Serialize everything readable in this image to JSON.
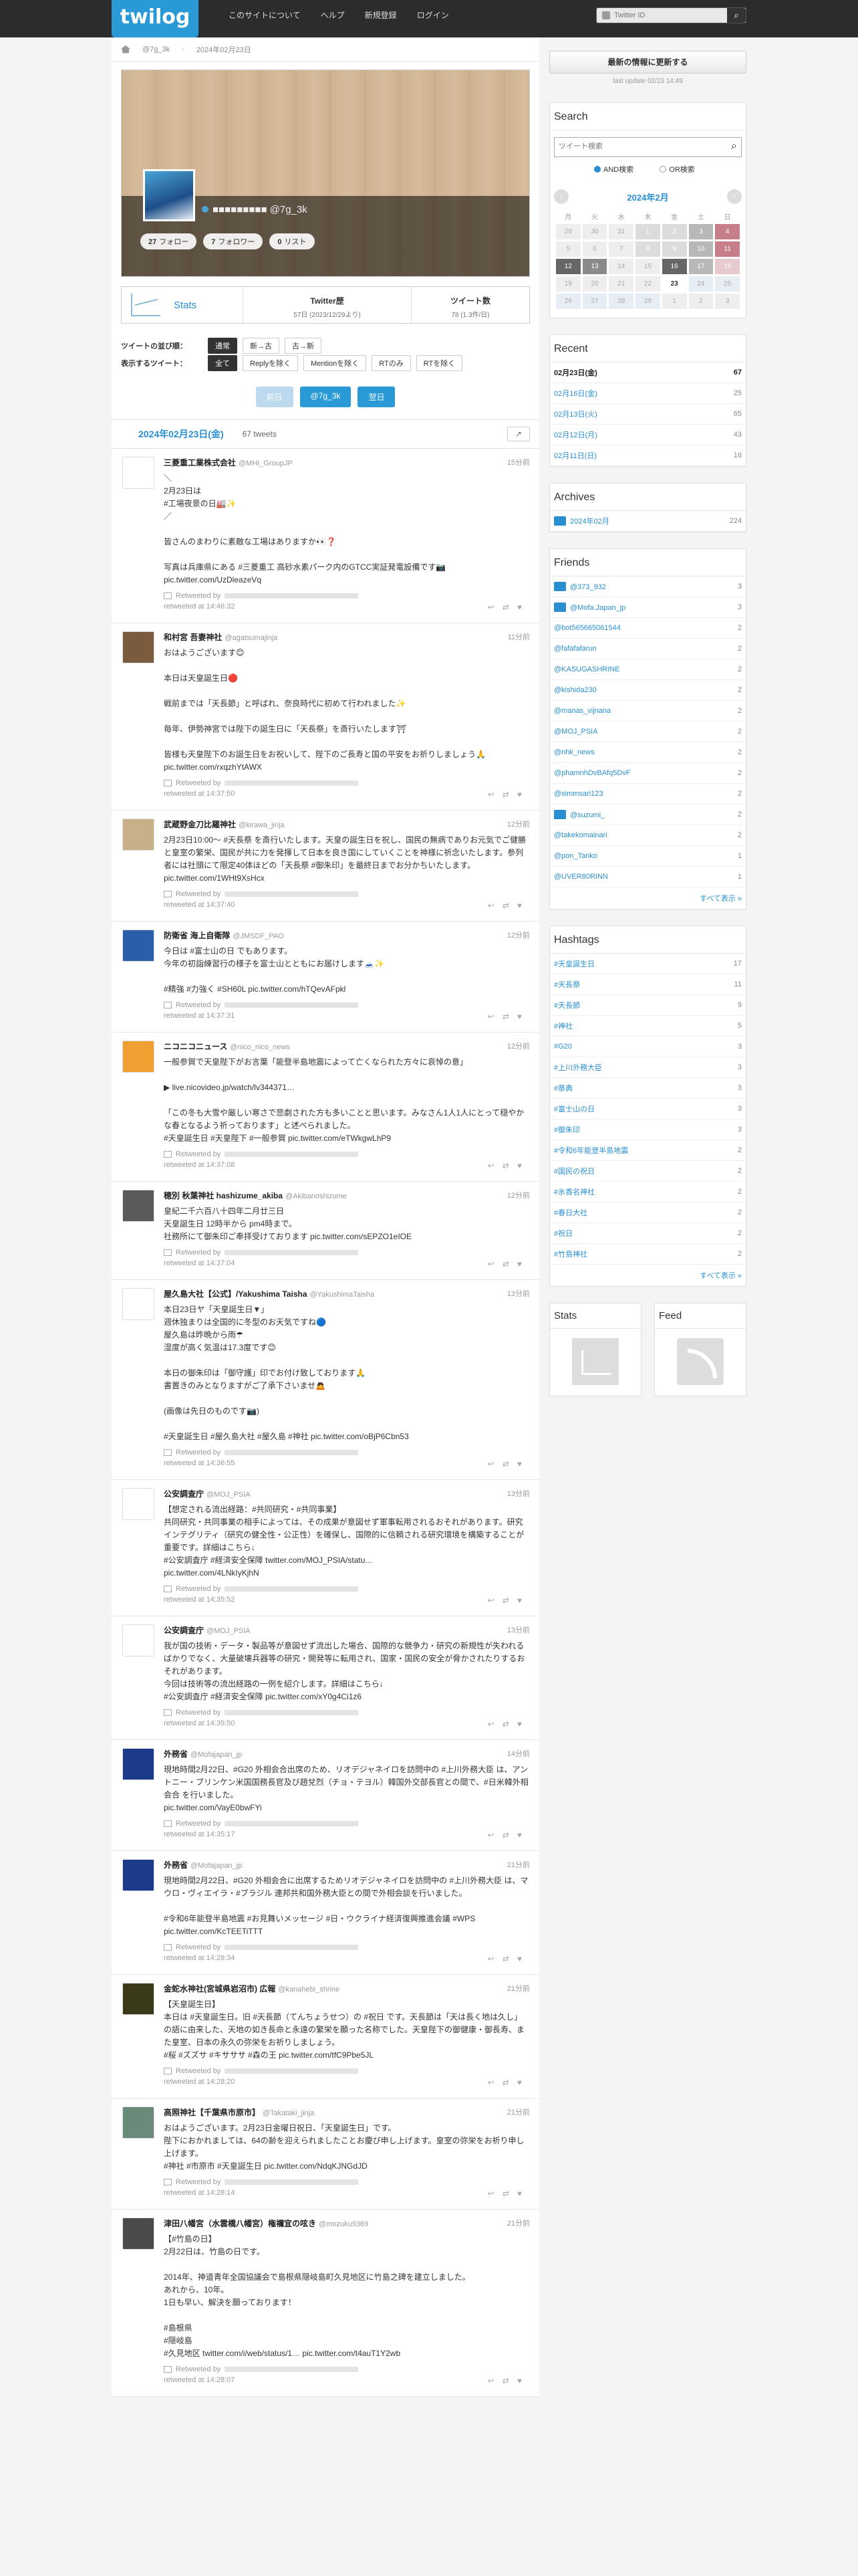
{
  "topbar": {
    "logo": "twilog",
    "nav": [
      "このサイトについて",
      "ヘルプ",
      "新規登録",
      "ログイン"
    ],
    "search_placeholder": "Twitter ID"
  },
  "breadcrumb": {
    "user": "@7g_3k",
    "date": "2024年02月23日"
  },
  "profile": {
    "name_masked": "■■■■■■■■■ @7g_3k",
    "pills": [
      {
        "num": "27",
        "label": "フォロー"
      },
      {
        "num": "7",
        "label": "フォロワー"
      },
      {
        "num": "0",
        "label": "リスト"
      }
    ]
  },
  "stats": {
    "label": "Stats",
    "twitter_reki_title": "Twitter歴",
    "twitter_reki_value": "57日 (2023/12/29より)",
    "tweets_title": "ツイート数",
    "tweets_value": "78 (1.3件/日)"
  },
  "options": {
    "order_label": "ツイートの並び順：",
    "order_buttons": [
      "通常",
      "新→古",
      "古→新"
    ],
    "display_label": "表示するツイート：",
    "display_buttons": [
      "全て",
      "Replyを除く",
      "Mentionを除く",
      "RTのみ",
      "RTを除く"
    ]
  },
  "pager": {
    "prev": "前日",
    "user": "@7g_3k",
    "next": "翌日"
  },
  "day": {
    "date": "2024年02月23日(金)",
    "count": "67 tweets",
    "share": "↗"
  },
  "tweets": [
    {
      "name": "三菱重工業株式会社",
      "sn": "@MHI_GroupJP",
      "time": "15分前",
      "av": "#fff url() ",
      "avc": "#ffffff",
      "avb": "#d00",
      "body": "＼\n2月23日は\n#工場夜景の日🏭✨\n／\n\n皆さんのまわりに素敵な工場はありますか👀❓\n\n写真は兵庫県にある #三菱重工 高砂水素パーク内のGTCC実証発電設備です📷\npic.twitter.com/UzDleazeVq",
      "at": "retweeted at 14:46:32"
    },
    {
      "name": "和村宮 吾妻神社",
      "sn": "@agatsumajinja",
      "time": "11分前",
      "avc": "#7a5b3e",
      "body": "おはようございます😊\n\n本日は天皇誕生日🔴\n\n戦前までは「天長節」と呼ばれ、奈良時代に初めて行われました✨\n\n毎年、伊勢神宮では陛下の誕生日に「天長祭」を斎行いたします⛩\n\n皆様も天皇陛下のお誕生日をお祝いして、陛下のご長寿と国の平安をお祈りしましょう🙏 pic.twitter.com/rxqzhYtAWX",
      "at": "retweeted at 14:37:50"
    },
    {
      "name": "武蔵野金刀比羅神社",
      "sn": "@kirawa_jinja",
      "time": "12分前",
      "avc": "#c8b08a",
      "body": "2月23日10:00〜 #天長祭 を斎行いたします。天皇の誕生日を祝し、国民の無病でありお元気でご健勝と皇室の繁栄、国民が共に力を発揮して日本を良き国にしていくことを神様に祈念いたします。参列者には社頭にて限定40体ほどの「天長祭 #御朱印」を最終日までお分かちいたします。 pic.twitter.com/1WHt9XsHcx",
      "at": "retweeted at 14:37:40"
    },
    {
      "name": "防衛省 海上自衛隊",
      "sn": "@JMSDF_PAO",
      "time": "12分前",
      "avc": "#2a5ea8",
      "body": "今日は #富士山の日 でもあります。\n今年の初詣練習行の様子を富士山とともにお届けします🗻✨\n\n#精強 #力強く #SH60L pic.twitter.com/hTQevAFpkl",
      "at": "retweeted at 14:37:31"
    },
    {
      "name": "ニコニコニュース",
      "sn": "@nico_nico_news",
      "time": "12分前",
      "avc": "#f0a030",
      "body": "一般参賀で天皇陛下がお言葉「能登半島地震によって亡くなられた方々に哀悼の意」\n\n▶ live.nicovideo.jp/watch/lv344371…\n\n「この冬も大雪や厳しい寒さで悲劇された方も多いことと思います。みなさん1人1人にとって穏やかな春となるよう祈っております」と述べられました。\n#天皇誕生日 #天皇陛下 #一般参賀 pic.twitter.com/eTWkgwLhP9",
      "at": "retweeted at 14:37:08"
    },
    {
      "name": "穂別 秋葉神社 hashizume_akiba",
      "sn": "@Akibanoshizume",
      "time": "12分前",
      "avc": "#5a5a5a",
      "body": "皇紀二千六百八十四年二月廿三日\n天皇誕生日 12時半から pm4時まで。\n社務所にて御朱印ご奉拝受けております pic.twitter.com/sEPZO1eIOE",
      "at": "retweeted at 14:37:04"
    },
    {
      "name": "屋久島大社【公式】/Yakushima Taisha",
      "sn": "@YakushimaTaisha",
      "time": "13分前",
      "avc": "#ffffff",
      "body": "本日23日ヤ「天皇誕生日▼」\n週休独まりは全国的に冬型のお天気ですね🔵\n屋久島は昨晩から雨☂\n湿度が高く気温は17.3度です😊\n\n本日の御朱印は「御守護」印でお付け致しております🙏\n書置きのみとなりますがご了承下さいませ🙇\n\n(画像は先日のものです📷)\n\n#天皇誕生日 #屋久島大社 #屋久島 #神社 pic.twitter.com/oBjP6Cbn53",
      "at": "retweeted at 14:36:55"
    },
    {
      "name": "公安調査庁",
      "sn": "@MOJ_PSIA",
      "time": "13分前",
      "avc": "#ffffff",
      "body": "【想定される流出経路：#共同研究・#共同事業】\n共同研究・共同事業の相手によっては、その成果が意図せず軍事転用されるおそれがあります。研究インテグリティ（研究の健全性・公正性）を確保し、国際的に信頼される研究環境を構築することが重要です。詳細はこちら↓\n#公安調査庁 #経済安全保障 twitter.com/MOJ_PSIA/statu…\npic.twitter.com/4LNkIyKjhN",
      "at": "retweeted at 14:35:52"
    },
    {
      "name": "公安調査庁",
      "sn": "@MOJ_PSIA",
      "time": "13分前",
      "avc": "#ffffff",
      "body": "我が国の技術・データ・製品等が意図せず流出した場合、国際的な競争力・研究の新規性が失われるばかりでなく、大量破壊兵器等の研究・開発等に転用され、国家・国民の安全が脅かされたりするおそれがあります。\n今回は技術等の流出経路の一例を紹介します。詳細はこちら↓\n#公安調査庁 #経済安全保障 pic.twitter.com/xY0g4Ci1z6",
      "at": "retweeted at 14:35:50"
    },
    {
      "name": "外務省",
      "sn": "@Mofajapan_jp",
      "time": "14分前",
      "avc": "#1c3a8a",
      "body": "現地時間2月22日、#G20 外相会合出席のため、リオデジャネイロを訪問中の #上川外務大臣 は、アントニー・ブリンケン米国国務長官及び趙兌烈（チョ・テヨル）韓国外交部長官との間で、#日米韓外相会合 を行いました。\npic.twitter.com/VayE0bwFYi",
      "at": "retweeted at 14:35:17"
    },
    {
      "name": "外務省",
      "sn": "@Mofajapan_jp",
      "time": "21分前",
      "avc": "#1c3a8a",
      "body": "現地時間2月22日、#G20 外相会合に出席するためリオデジャネイロを訪問中の #上川外務大臣 は、マウロ・ヴィエイラ・#ブラジル 連邦共和国外務大臣との間で外相会談を行いました。\n\n#令和6年能登半島地震 #お見舞いメッセージ #日・ウクライナ経済復興推進会議 #WPS pic.twitter.com/KcTEETiTTT",
      "at": "retweeted at 14:28:34"
    },
    {
      "name": "金蛇水神社(宮城県岩沼市) 広報",
      "sn": "@kanahebi_shrine",
      "time": "21分前",
      "avc": "#3a3a1a",
      "body": "【天皇誕生日】\n本日は #天皇誕生日。旧 #天長節（てんちょうせつ）の #祝日 です。天長節は「天は長く地は久し」の語に由来した、天地の如き長命と永遠の繁栄を願った名称でした。天皇陛下の御健康・御長寿、また皇室、日本の永久の弥栄をお祈りしましょう。\n#桜 #ズズサ #キサササ #森の王 pic.twitter.com/tfC9Pbe5JL",
      "at": "retweeted at 14:28:20"
    },
    {
      "name": "高照神社【千葉県市原市】",
      "sn": "@Takataki_jinja",
      "time": "21分前",
      "avc": "#6a8a7a",
      "body": "おはようございます。2月23日金曜日祝日、「天皇誕生日」です。\n陛下におかれましては、64の齢を迎えられましたことお慶び申し上げます。皇室の弥栄をお祈り申し上げます。\n#神社 #市原市 #天皇誕生日 pic.twitter.com/NdqKJNGdJD",
      "at": "retweeted at 14:28:14"
    },
    {
      "name": "津田八幡宮（水雲橋八幡宮）権禰宜の呟き",
      "sn": "@mozuku9369",
      "time": "21分前",
      "avc": "#4a4a4a",
      "body": "【#竹島の日】\n2月22日は、竹島の日です。\n\n2014年、神道青年全国協議会で島根県隠岐島町久見地区に竹島之碑を建立しました。\nあれから、10年。\n1日も早い、解決を願っております！\n\n#島根県\n#隠岐島\n#久見地区 twitter.com/i/web/status/1… pic.twitter.com/t4auT1Y2wb",
      "at": "retweeted at 14:28:07"
    }
  ],
  "side": {
    "update_button": "最新の情報に更新する",
    "update_note": "last update 02/23 14:49",
    "search_title": "Search",
    "search_placeholder": "ツイート検索",
    "radio_and": "AND検索",
    "radio_or": "OR検索",
    "cal_title": "2024年2月",
    "cal_days": [
      "月",
      "火",
      "水",
      "木",
      "金",
      "土",
      "日"
    ],
    "cal_rows": [
      [
        "29",
        "30",
        "31",
        "1",
        "2",
        "3",
        "4"
      ],
      [
        "5",
        "6",
        "7",
        "8",
        "9",
        "10",
        "11"
      ],
      [
        "12",
        "13",
        "14",
        "15",
        "16",
        "17",
        "18"
      ],
      [
        "19",
        "20",
        "21",
        "22",
        "23",
        "24",
        "25"
      ],
      [
        "26",
        "27",
        "28",
        "29",
        "1",
        "2",
        "3"
      ]
    ],
    "recent_title": "Recent",
    "recent": [
      {
        "k": "02月23日(金)",
        "v": "67",
        "bold": true
      },
      {
        "k": "02月16日(金)",
        "v": "25"
      },
      {
        "k": "02月13日(火)",
        "v": "65"
      },
      {
        "k": "02月12日(月)",
        "v": "43"
      },
      {
        "k": "02月11日(日)",
        "v": "16"
      }
    ],
    "archives_title": "Archives",
    "archives": [
      {
        "k": "2024年02月",
        "v": "224"
      }
    ],
    "friends_title": "Friends",
    "friends": [
      {
        "k": "@373_932",
        "v": "3",
        "icon": true
      },
      {
        "k": "@Mofa.Japan_jp",
        "v": "3",
        "icon": true
      },
      {
        "k": "@bot565665061544",
        "v": "2"
      },
      {
        "k": "@fafafafarun",
        "v": "2"
      },
      {
        "k": "@KASUGASHRINE",
        "v": "2"
      },
      {
        "k": "@kishida230",
        "v": "2"
      },
      {
        "k": "@manas_vijnana",
        "v": "2"
      },
      {
        "k": "@MOJ_PSIA",
        "v": "2"
      },
      {
        "k": "@nhk_news",
        "v": "2"
      },
      {
        "k": "@phamnhDvBAfq5DvF",
        "v": "2"
      },
      {
        "k": "@simmsari123",
        "v": "2"
      },
      {
        "k": "@suzumi_",
        "v": "2",
        "icon": true
      },
      {
        "k": "@takekomainari",
        "v": "2"
      },
      {
        "k": "@pon_Tanko",
        "v": "1"
      },
      {
        "k": "@UVER80RINN",
        "v": "1"
      }
    ],
    "friends_more": "すべて表示 »",
    "hashtags_title": "Hashtags",
    "hashtags": [
      {
        "k": "#天皇誕生日",
        "v": "17"
      },
      {
        "k": "#天長祭",
        "v": "11"
      },
      {
        "k": "#天長節",
        "v": "9"
      },
      {
        "k": "#神社",
        "v": "5"
      },
      {
        "k": "#G20",
        "v": "3"
      },
      {
        "k": "#上川外務大臣",
        "v": "3"
      },
      {
        "k": "#祭典",
        "v": "3"
      },
      {
        "k": "#富士山の日",
        "v": "3"
      },
      {
        "k": "#御朱印",
        "v": "3"
      },
      {
        "k": "#令和6年能登半島地震",
        "v": "2"
      },
      {
        "k": "#国民の祝日",
        "v": "2"
      },
      {
        "k": "#氷香名神社",
        "v": "2"
      },
      {
        "k": "#春日大社",
        "v": "2"
      },
      {
        "k": "#祝日",
        "v": "2"
      },
      {
        "k": "#竹島神社",
        "v": "2"
      }
    ],
    "hashtags_more": "すべて表示 »",
    "stats_title": "Stats",
    "feed_title": "Feed"
  }
}
